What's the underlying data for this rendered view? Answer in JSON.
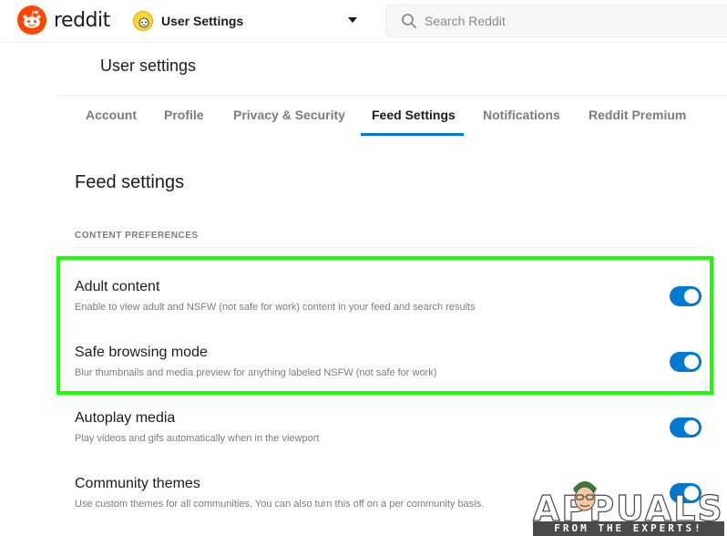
{
  "header": {
    "logo_text": "reddit",
    "community_label": "User Settings",
    "search_placeholder": "Search Reddit"
  },
  "page": {
    "title": "User settings"
  },
  "tabs": [
    {
      "label": "Account",
      "active": false
    },
    {
      "label": "Profile",
      "active": false
    },
    {
      "label": "Privacy & Security",
      "active": false
    },
    {
      "label": "Feed Settings",
      "active": true
    },
    {
      "label": "Notifications",
      "active": false
    },
    {
      "label": "Reddit Premium",
      "active": false
    }
  ],
  "feed": {
    "section_title": "Feed settings",
    "group_label": "CONTENT PREFERENCES",
    "rows": [
      {
        "title": "Adult content",
        "description": "Enable to view adult and NSFW (not safe for work) content in your feed and search results",
        "enabled": true
      },
      {
        "title": "Safe browsing mode",
        "description": "Blur thumbnails and media preview for anything labeled NSFW (not safe for work)",
        "enabled": true
      },
      {
        "title": "Autoplay media",
        "description": "Play videos and gifs automatically when in the viewport",
        "enabled": true
      },
      {
        "title": "Community themes",
        "description": "Use custom themes for all communities. You can also turn this off on a per community basis.",
        "enabled": true
      }
    ]
  },
  "watermark": {
    "brand": "APPUALS",
    "tagline": "FROM THE EXPERTS!"
  },
  "colors": {
    "brand": "#ff4500",
    "accent": "#0079d3",
    "highlight": "#18ff00"
  }
}
